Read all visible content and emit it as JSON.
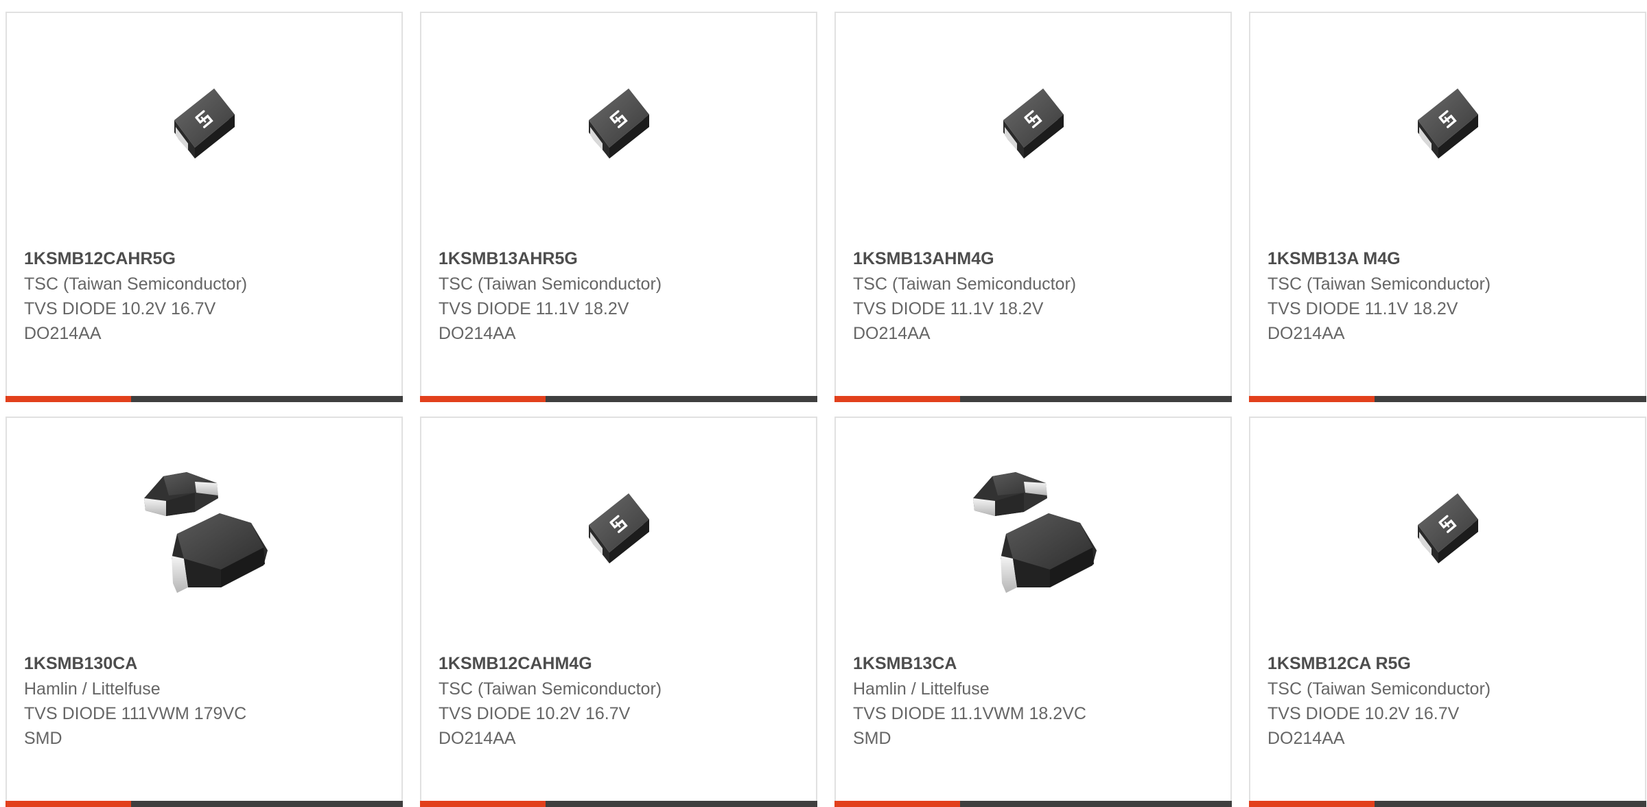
{
  "products": [
    {
      "part_number": "1KSMB12CAHR5G",
      "manufacturer": "TSC (Taiwan Semiconductor)",
      "description": "TVS DIODE 10.2V 16.7V",
      "package": "DO214AA",
      "image_icon": "smb-diode-tsc-icon"
    },
    {
      "part_number": "1KSMB13AHR5G",
      "manufacturer": "TSC (Taiwan Semiconductor)",
      "description": "TVS DIODE 11.1V 18.2V",
      "package": "DO214AA",
      "image_icon": "smb-diode-tsc-icon"
    },
    {
      "part_number": "1KSMB13AHM4G",
      "manufacturer": "TSC (Taiwan Semiconductor)",
      "description": "TVS DIODE 11.1V 18.2V",
      "package": "DO214AA",
      "image_icon": "smb-diode-tsc-icon"
    },
    {
      "part_number": "1KSMB13A M4G",
      "manufacturer": "TSC (Taiwan Semiconductor)",
      "description": "TVS DIODE 11.1V 18.2V",
      "package": "DO214AA",
      "image_icon": "smb-diode-tsc-icon"
    },
    {
      "part_number": "1KSMB130CA",
      "manufacturer": "Hamlin / Littelfuse",
      "description": "TVS DIODE 111VWM 179VC",
      "package": "SMD",
      "image_icon": "smb-diode-pair-icon"
    },
    {
      "part_number": "1KSMB12CAHM4G",
      "manufacturer": "TSC (Taiwan Semiconductor)",
      "description": "TVS DIODE 10.2V 16.7V",
      "package": "DO214AA",
      "image_icon": "smb-diode-tsc-icon"
    },
    {
      "part_number": "1KSMB13CA",
      "manufacturer": "Hamlin / Littelfuse",
      "description": "TVS DIODE 11.1VWM 18.2VC",
      "package": "SMD",
      "image_icon": "smb-diode-pair-icon"
    },
    {
      "part_number": "1KSMB12CA R5G",
      "manufacturer": "TSC (Taiwan Semiconductor)",
      "description": "TVS DIODE 10.2V 16.7V",
      "package": "DO214AA",
      "image_icon": "smb-diode-tsc-icon"
    }
  ],
  "colors": {
    "accent_bar": "#e2401c",
    "dark_bar": "#3f3f3f",
    "card_border": "#e1e1e1",
    "part_number_text": "#4d4d4d",
    "body_text": "#666666"
  }
}
